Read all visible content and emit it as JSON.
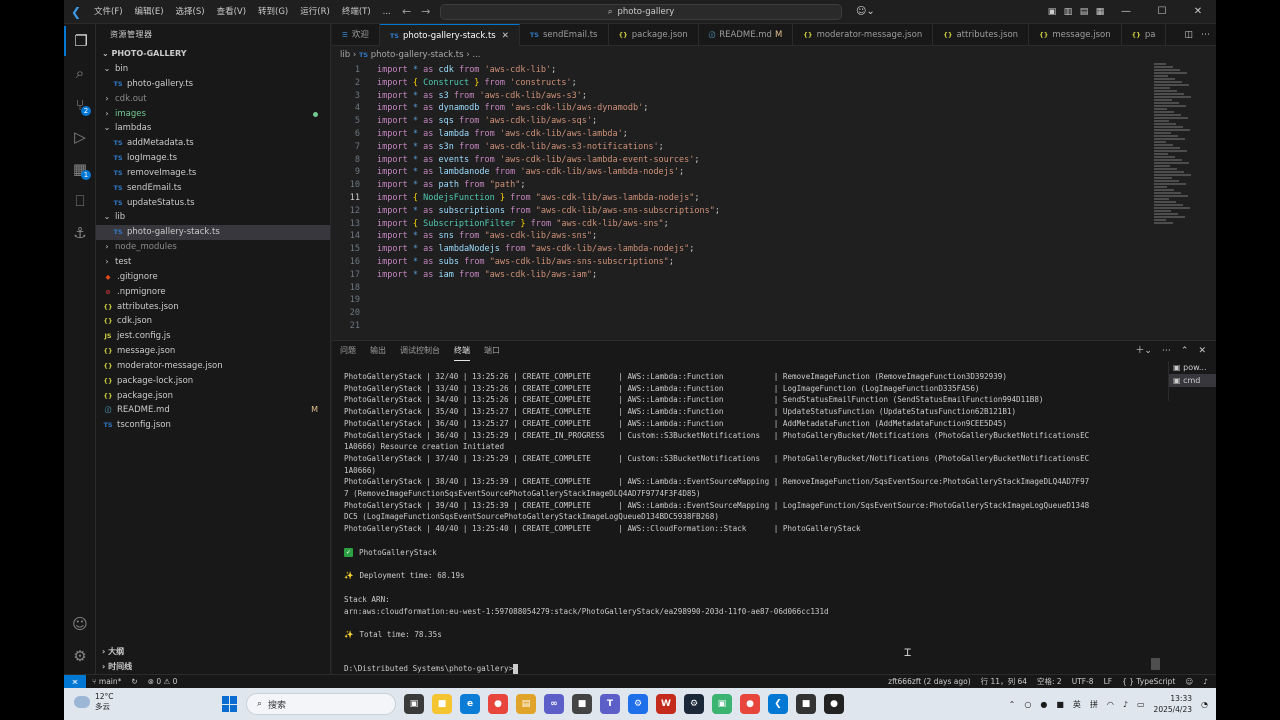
{
  "titlebar": {
    "menus": [
      "文件(F)",
      "编辑(E)",
      "选择(S)",
      "查看(V)",
      "转到(G)",
      "运行(R)",
      "终端(T)",
      "..."
    ],
    "search": "photo-gallery"
  },
  "sidebar": {
    "header": "资源管理器",
    "root": "PHOTO-GALLERY",
    "items": [
      {
        "label": "bin",
        "kind": "folder-open",
        "indent": 1
      },
      {
        "label": "photo-gallery.ts",
        "kind": "ts",
        "indent": 2
      },
      {
        "label": "cdk.out",
        "kind": "folder",
        "indent": 1,
        "dim": true
      },
      {
        "label": "images",
        "kind": "folder",
        "indent": 1,
        "green": true,
        "dot": true
      },
      {
        "label": "lambdas",
        "kind": "folder-open",
        "indent": 1
      },
      {
        "label": "addMetadata.ts",
        "kind": "ts",
        "indent": 2
      },
      {
        "label": "logImage.ts",
        "kind": "ts",
        "indent": 2
      },
      {
        "label": "removeImage.ts",
        "kind": "ts",
        "indent": 2
      },
      {
        "label": "sendEmail.ts",
        "kind": "ts",
        "indent": 2
      },
      {
        "label": "updateStatus.ts",
        "kind": "ts",
        "indent": 2
      },
      {
        "label": "lib",
        "kind": "folder-open",
        "indent": 1
      },
      {
        "label": "photo-gallery-stack.ts",
        "kind": "ts",
        "indent": 2,
        "selected": true
      },
      {
        "label": "node_modules",
        "kind": "folder",
        "indent": 1,
        "dim": true
      },
      {
        "label": "test",
        "kind": "folder",
        "indent": 1
      },
      {
        "label": ".gitignore",
        "kind": "git",
        "indent": 1
      },
      {
        "label": ".npmignore",
        "kind": "npm",
        "indent": 1
      },
      {
        "label": "attributes.json",
        "kind": "json",
        "indent": 1
      },
      {
        "label": "cdk.json",
        "kind": "json",
        "indent": 1
      },
      {
        "label": "jest.config.js",
        "kind": "js",
        "indent": 1
      },
      {
        "label": "message.json",
        "kind": "json",
        "indent": 1
      },
      {
        "label": "moderator-message.json",
        "kind": "json",
        "indent": 1
      },
      {
        "label": "package-lock.json",
        "kind": "json",
        "indent": 1
      },
      {
        "label": "package.json",
        "kind": "json",
        "indent": 1
      },
      {
        "label": "README.md",
        "kind": "md",
        "indent": 1,
        "modified": "M"
      },
      {
        "label": "tsconfig.json",
        "kind": "ts",
        "indent": 1
      }
    ],
    "outline": "大纲",
    "timeline": "时间线"
  },
  "tabs": [
    {
      "label": "欢迎",
      "icon": "welcome-icon"
    },
    {
      "label": "photo-gallery-stack.ts",
      "icon": "TS",
      "active": true
    },
    {
      "label": "sendEmail.ts",
      "icon": "TS"
    },
    {
      "label": "package.json",
      "icon": "{}"
    },
    {
      "label": "README.md",
      "icon": "ⓘ",
      "mod": "M"
    },
    {
      "label": "moderator-message.json",
      "icon": "{}"
    },
    {
      "label": "attributes.json",
      "icon": "{}"
    },
    {
      "label": "message.json",
      "icon": "{}"
    },
    {
      "label": "pa",
      "icon": "{}"
    }
  ],
  "breadcrumb": [
    "lib",
    "photo-gallery-stack.ts"
  ],
  "editor": {
    "current_line": 11,
    "lines": [
      [
        [
          "kw",
          "import"
        ],
        [
          "pun",
          " "
        ],
        [
          "kw2",
          "*"
        ],
        [
          "pun",
          " "
        ],
        [
          "kw",
          "as"
        ],
        [
          "pun",
          " "
        ],
        [
          "id",
          "cdk"
        ],
        [
          "pun",
          " "
        ],
        [
          "kw",
          "from"
        ],
        [
          "pun",
          " "
        ],
        [
          "str",
          "'aws-cdk-lib'"
        ],
        [
          "pun",
          ";"
        ]
      ],
      [
        [
          "kw",
          "import"
        ],
        [
          "pun",
          " "
        ],
        [
          "br",
          "{"
        ],
        [
          "pun",
          " "
        ],
        [
          "cls",
          "Construct"
        ],
        [
          "pun",
          " "
        ],
        [
          "br",
          "}"
        ],
        [
          "pun",
          " "
        ],
        [
          "kw",
          "from"
        ],
        [
          "pun",
          " "
        ],
        [
          "str",
          "'constructs'"
        ],
        [
          "pun",
          ";"
        ]
      ],
      [
        [
          "kw",
          "import"
        ],
        [
          "pun",
          " "
        ],
        [
          "kw2",
          "*"
        ],
        [
          "pun",
          " "
        ],
        [
          "kw",
          "as"
        ],
        [
          "pun",
          " "
        ],
        [
          "id",
          "s3"
        ],
        [
          "pun",
          " "
        ],
        [
          "kw",
          "from"
        ],
        [
          "pun",
          " "
        ],
        [
          "str",
          "'aws-cdk-lib/aws-s3'"
        ],
        [
          "pun",
          ";"
        ]
      ],
      [
        [
          "kw",
          "import"
        ],
        [
          "pun",
          " "
        ],
        [
          "kw2",
          "*"
        ],
        [
          "pun",
          " "
        ],
        [
          "kw",
          "as"
        ],
        [
          "pun",
          " "
        ],
        [
          "id",
          "dynamodb"
        ],
        [
          "pun",
          " "
        ],
        [
          "kw",
          "from"
        ],
        [
          "pun",
          " "
        ],
        [
          "str",
          "'aws-cdk-lib/aws-dynamodb'"
        ],
        [
          "pun",
          ";"
        ]
      ],
      [
        [
          "kw",
          "import"
        ],
        [
          "pun",
          " "
        ],
        [
          "kw2",
          "*"
        ],
        [
          "pun",
          " "
        ],
        [
          "kw",
          "as"
        ],
        [
          "pun",
          " "
        ],
        [
          "id",
          "sqs"
        ],
        [
          "pun",
          " "
        ],
        [
          "kw",
          "from"
        ],
        [
          "pun",
          " "
        ],
        [
          "str",
          "'aws-cdk-lib/aws-sqs'"
        ],
        [
          "pun",
          ";"
        ]
      ],
      [
        [
          "kw",
          "import"
        ],
        [
          "pun",
          " "
        ],
        [
          "kw2",
          "*"
        ],
        [
          "pun",
          " "
        ],
        [
          "kw",
          "as"
        ],
        [
          "pun",
          " "
        ],
        [
          "id",
          "lambda"
        ],
        [
          "pun",
          " "
        ],
        [
          "kw",
          "from"
        ],
        [
          "pun",
          " "
        ],
        [
          "str",
          "'aws-cdk-lib/aws-lambda'"
        ],
        [
          "pun",
          ";"
        ]
      ],
      [
        [
          "kw",
          "import"
        ],
        [
          "pun",
          " "
        ],
        [
          "kw2",
          "*"
        ],
        [
          "pun",
          " "
        ],
        [
          "kw",
          "as"
        ],
        [
          "pun",
          " "
        ],
        [
          "id",
          "s3n"
        ],
        [
          "pun",
          " "
        ],
        [
          "kw",
          "from"
        ],
        [
          "pun",
          " "
        ],
        [
          "str",
          "'aws-cdk-lib/aws-s3-notifications'"
        ],
        [
          "pun",
          ";"
        ]
      ],
      [
        [
          "kw",
          "import"
        ],
        [
          "pun",
          " "
        ],
        [
          "kw2",
          "*"
        ],
        [
          "pun",
          " "
        ],
        [
          "kw",
          "as"
        ],
        [
          "pun",
          " "
        ],
        [
          "id",
          "events"
        ],
        [
          "pun",
          " "
        ],
        [
          "kw",
          "from"
        ],
        [
          "pun",
          " "
        ],
        [
          "str",
          "'aws-cdk-lib/aws-lambda-event-sources'"
        ],
        [
          "pun",
          ";"
        ]
      ],
      [
        [
          "kw",
          "import"
        ],
        [
          "pun",
          " "
        ],
        [
          "kw2",
          "*"
        ],
        [
          "pun",
          " "
        ],
        [
          "kw",
          "as"
        ],
        [
          "pun",
          " "
        ],
        [
          "id",
          "lambdanode"
        ],
        [
          "pun",
          " "
        ],
        [
          "kw",
          "from"
        ],
        [
          "pun",
          " "
        ],
        [
          "str",
          "'aws-cdk-lib/aws-lambda-nodejs'"
        ],
        [
          "pun",
          ";"
        ]
      ],
      [
        [
          "kw",
          "import"
        ],
        [
          "pun",
          " "
        ],
        [
          "kw2",
          "*"
        ],
        [
          "pun",
          " "
        ],
        [
          "kw",
          "as"
        ],
        [
          "pun",
          " "
        ],
        [
          "id",
          "path"
        ],
        [
          "pun",
          " "
        ],
        [
          "kw",
          "from"
        ],
        [
          "pun",
          " "
        ],
        [
          "str",
          "\"path\""
        ],
        [
          "pun",
          ";"
        ]
      ],
      [
        [
          "kw",
          "import"
        ],
        [
          "pun",
          " "
        ],
        [
          "br",
          "{"
        ],
        [
          "pun",
          " "
        ],
        [
          "cls",
          "NodejsFunction"
        ],
        [
          "pun",
          " "
        ],
        [
          "br",
          "}"
        ],
        [
          "pun",
          " "
        ],
        [
          "kw",
          "from"
        ],
        [
          "pun",
          " "
        ],
        [
          "str",
          "\"aws-cdk-lib/aws-lambda-nodejs\""
        ],
        [
          "pun",
          ";"
        ]
      ],
      [
        [
          "kw",
          "import"
        ],
        [
          "pun",
          " "
        ],
        [
          "kw2",
          "*"
        ],
        [
          "pun",
          " "
        ],
        [
          "kw",
          "as"
        ],
        [
          "pun",
          " "
        ],
        [
          "id",
          "subscriptions"
        ],
        [
          "pun",
          " "
        ],
        [
          "kw",
          "from"
        ],
        [
          "pun",
          " "
        ],
        [
          "str",
          "\"aws-cdk-lib/aws-sns-subscriptions\""
        ],
        [
          "pun",
          ";"
        ]
      ],
      [
        [
          "kw",
          "import"
        ],
        [
          "pun",
          " "
        ],
        [
          "br",
          "{"
        ],
        [
          "pun",
          " "
        ],
        [
          "cls",
          "SubscriptionFilter"
        ],
        [
          "pun",
          " "
        ],
        [
          "br",
          "}"
        ],
        [
          "pun",
          " "
        ],
        [
          "kw",
          "from"
        ],
        [
          "pun",
          " "
        ],
        [
          "str",
          "\"aws-cdk-lib/aws-sns\""
        ],
        [
          "pun",
          ";"
        ]
      ],
      [
        [
          "kw",
          "import"
        ],
        [
          "pun",
          " "
        ],
        [
          "kw2",
          "*"
        ],
        [
          "pun",
          " "
        ],
        [
          "kw",
          "as"
        ],
        [
          "pun",
          " "
        ],
        [
          "id",
          "sns"
        ],
        [
          "pun",
          " "
        ],
        [
          "kw",
          "from"
        ],
        [
          "pun",
          " "
        ],
        [
          "str",
          "\"aws-cdk-lib/aws-sns\""
        ],
        [
          "pun",
          ";"
        ]
      ],
      [
        [
          "kw",
          "import"
        ],
        [
          "pun",
          " "
        ],
        [
          "kw2",
          "*"
        ],
        [
          "pun",
          " "
        ],
        [
          "kw",
          "as"
        ],
        [
          "pun",
          " "
        ],
        [
          "id",
          "lambdaNodejs"
        ],
        [
          "pun",
          " "
        ],
        [
          "kw",
          "from"
        ],
        [
          "pun",
          " "
        ],
        [
          "str",
          "\"aws-cdk-lib/aws-lambda-nodejs\""
        ],
        [
          "pun",
          ";"
        ]
      ],
      [
        [
          "kw",
          "import"
        ],
        [
          "pun",
          " "
        ],
        [
          "kw2",
          "*"
        ],
        [
          "pun",
          " "
        ],
        [
          "kw",
          "as"
        ],
        [
          "pun",
          " "
        ],
        [
          "id",
          "subs"
        ],
        [
          "pun",
          " "
        ],
        [
          "kw",
          "from"
        ],
        [
          "pun",
          " "
        ],
        [
          "str",
          "\"aws-cdk-lib/aws-sns-subscriptions\""
        ],
        [
          "pun",
          ";"
        ]
      ],
      [
        [
          "kw",
          "import"
        ],
        [
          "pun",
          " "
        ],
        [
          "kw2",
          "*"
        ],
        [
          "pun",
          " "
        ],
        [
          "kw",
          "as"
        ],
        [
          "pun",
          " "
        ],
        [
          "id",
          "iam"
        ],
        [
          "pun",
          " "
        ],
        [
          "kw",
          "from"
        ],
        [
          "pun",
          " "
        ],
        [
          "str",
          "\"aws-cdk-lib/aws-iam\""
        ],
        [
          "pun",
          ";"
        ]
      ],
      [],
      [],
      [],
      []
    ]
  },
  "panel": {
    "tabs": [
      "问题",
      "输出",
      "调试控制台",
      "终端",
      "端口"
    ],
    "active_tab": "终端",
    "terminal_list": [
      "pow...",
      "cmd"
    ],
    "lines": [
      "PhotoGalleryStack | 32/40 | 13:25:26 | CREATE_COMPLETE      | AWS::Lambda::Function           | RemoveImageFunction (RemoveImageFunction3D392939)",
      "PhotoGalleryStack | 33/40 | 13:25:26 | CREATE_COMPLETE      | AWS::Lambda::Function           | LogImageFunction (LogImageFunctionD335FA56)",
      "PhotoGalleryStack | 34/40 | 13:25:26 | CREATE_COMPLETE      | AWS::Lambda::Function           | SendStatusEmailFunction (SendStatusEmailFunction994D11B8)",
      "PhotoGalleryStack | 35/40 | 13:25:27 | CREATE_COMPLETE      | AWS::Lambda::Function           | UpdateStatusFunction (UpdateStatusFunction62B121B1)",
      "PhotoGalleryStack | 36/40 | 13:25:27 | CREATE_COMPLETE      | AWS::Lambda::Function           | AddMetadataFunction (AddMetadataFunction9CEE5D45)",
      "PhotoGalleryStack | 36/40 | 13:25:29 | CREATE_IN_PROGRESS   | Custom::S3BucketNotifications   | PhotoGalleryBucket/Notifications (PhotoGalleryBucketNotificationsEC",
      "1A0666) Resource creation Initiated",
      "PhotoGalleryStack | 37/40 | 13:25:29 | CREATE_COMPLETE      | Custom::S3BucketNotifications   | PhotoGalleryBucket/Notifications (PhotoGalleryBucketNotificationsEC",
      "1A0666)",
      "PhotoGalleryStack | 38/40 | 13:25:39 | CREATE_COMPLETE      | AWS::Lambda::EventSourceMapping | RemoveImageFunction/SqsEventSource:PhotoGalleryStackImageDLQ4AD7F97",
      "7 (RemoveImageFunctionSqsEventSourcePhotoGalleryStackImageDLQ4AD7F9774F3F4D85)",
      "PhotoGalleryStack | 39/40 | 13:25:39 | CREATE_COMPLETE      | AWS::Lambda::EventSourceMapping | LogImageFunction/SqsEventSource:PhotoGalleryStackImageLogQueueD1348",
      "DC5 (LogImageFunctionSqsEventSourcePhotoGalleryStackImageLogQueueD134BDC5938FB268)",
      "PhotoGalleryStack | 40/40 | 13:25:40 | CREATE_COMPLETE      | AWS::CloudFormation::Stack      | PhotoGalleryStack"
    ],
    "success_stack": "PhotoGalleryStack",
    "deploy_time": "Deployment time: 68.19s",
    "arn_label": "Stack ARN:",
    "arn": "arn:aws:cloudformation:eu-west-1:597088054279:stack/PhotoGalleryStack/ea298990-203d-11f0-ae87-06d066cc131d",
    "total_time": "Total time: 78.35s",
    "prompt": "D:\\Distributed Systems\\photo-gallery>"
  },
  "statusbar": {
    "branch": "main*",
    "errors": "⊗ 0 ⚠ 0",
    "blame": "zft666zft (2 days ago)",
    "position": "行 11，列 64",
    "spaces": "空格: 2",
    "encoding": "UTF-8",
    "eol": "LF",
    "language": "{ } TypeScript"
  },
  "taskbar": {
    "temp": "12°C",
    "weather": "多云",
    "search": "搜索",
    "ime1": "英",
    "ime2": "拼",
    "time": "13:33",
    "date": "2025/4/23"
  }
}
